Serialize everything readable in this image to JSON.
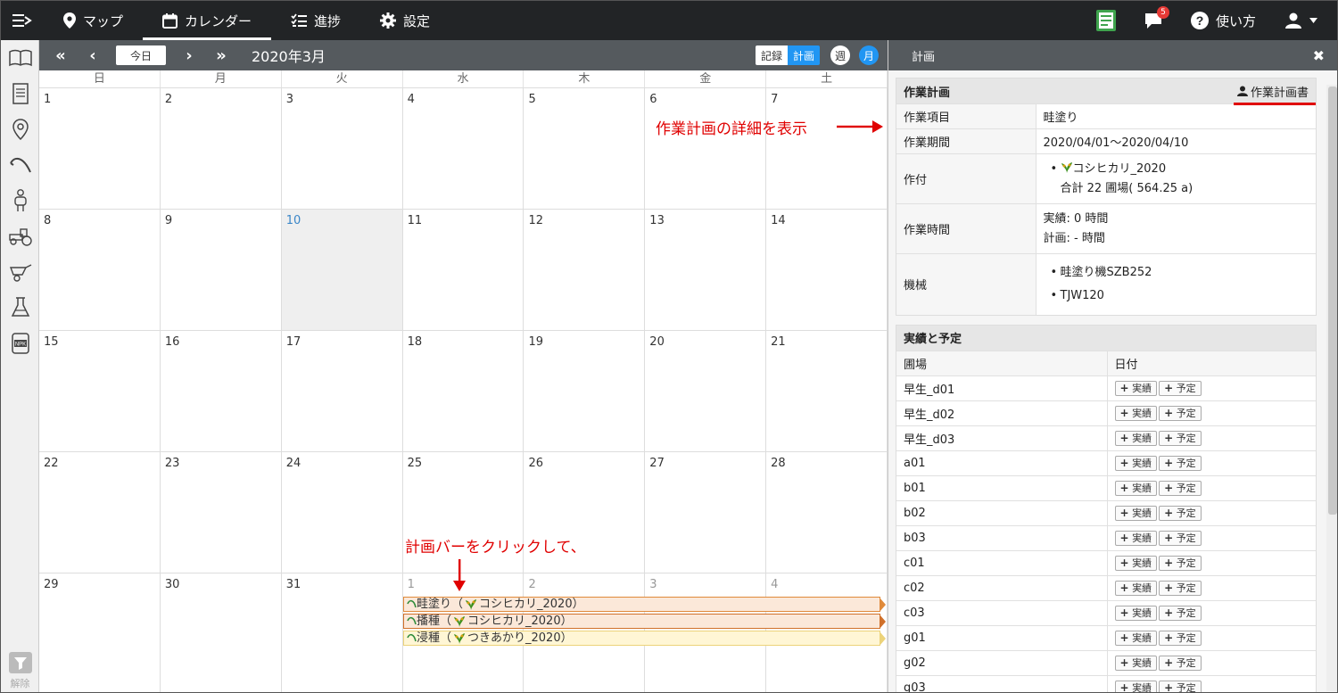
{
  "nav": {
    "items": [
      {
        "label": "マップ",
        "icon": "map-pin-icon"
      },
      {
        "label": "カレンダー",
        "icon": "calendar-icon",
        "active": true
      },
      {
        "label": "進捗",
        "icon": "checklist-icon"
      },
      {
        "label": "設定",
        "icon": "gear-icon"
      }
    ],
    "notification_count": "5",
    "help_label": "使い方"
  },
  "toolbar": {
    "today_label": "今日",
    "month_title": "2020年3月",
    "record_label": "記録",
    "plan_label": "計画",
    "week_label": "週",
    "month_label": "月"
  },
  "calendar": {
    "weekdays": [
      "日",
      "月",
      "火",
      "水",
      "木",
      "金",
      "土"
    ],
    "weeks": [
      [
        "1",
        "2",
        "3",
        "4",
        "5",
        "6",
        "7"
      ],
      [
        "8",
        "9",
        "10",
        "11",
        "12",
        "13",
        "14"
      ],
      [
        "15",
        "16",
        "17",
        "18",
        "19",
        "20",
        "21"
      ],
      [
        "22",
        "23",
        "24",
        "25",
        "26",
        "27",
        "28"
      ],
      [
        "29",
        "30",
        "31",
        "1",
        "2",
        "3",
        "4"
      ]
    ],
    "events": [
      {
        "label": "畦塗り（",
        "crop": "コシヒカリ_2020）"
      },
      {
        "label": "播種（",
        "crop": "コシヒカリ_2020）"
      },
      {
        "label": "浸種（",
        "crop": "つきあかり_2020）"
      }
    ]
  },
  "annotations": {
    "click_bar": "計画バーをクリックして、",
    "show_detail": "作業計画の詳細を表示"
  },
  "sidebar": {
    "filter_label": "解除"
  },
  "panel": {
    "title": "計画",
    "plan_section_title": "作業計画",
    "plan_doc_label": "作業計画書",
    "rows": {
      "item_key": "作業項目",
      "item_val": "畦塗り",
      "period_key": "作業期間",
      "period_val": "2020/04/01〜2020/04/10",
      "crop_key": "作付",
      "crop_val": "コシヒカリ_2020",
      "crop_total": "合計 22 圃場( 564.25 a)",
      "time_key": "作業時間",
      "time_actual": "実績: 0 時間",
      "time_plan": "計画: - 時間",
      "machine_key": "機械",
      "machine_1": "畦塗り機SZB252",
      "machine_2": "TJW120"
    },
    "results_section_title": "実績と予定",
    "field_col": "圃場",
    "date_col": "日付",
    "actual_btn": "実績",
    "plan_btn": "予定",
    "fields": [
      "早生_d01",
      "早生_d02",
      "早生_d03",
      "a01",
      "b01",
      "b02",
      "b03",
      "c01",
      "c02",
      "c03",
      "g01",
      "g02",
      "g03"
    ]
  }
}
